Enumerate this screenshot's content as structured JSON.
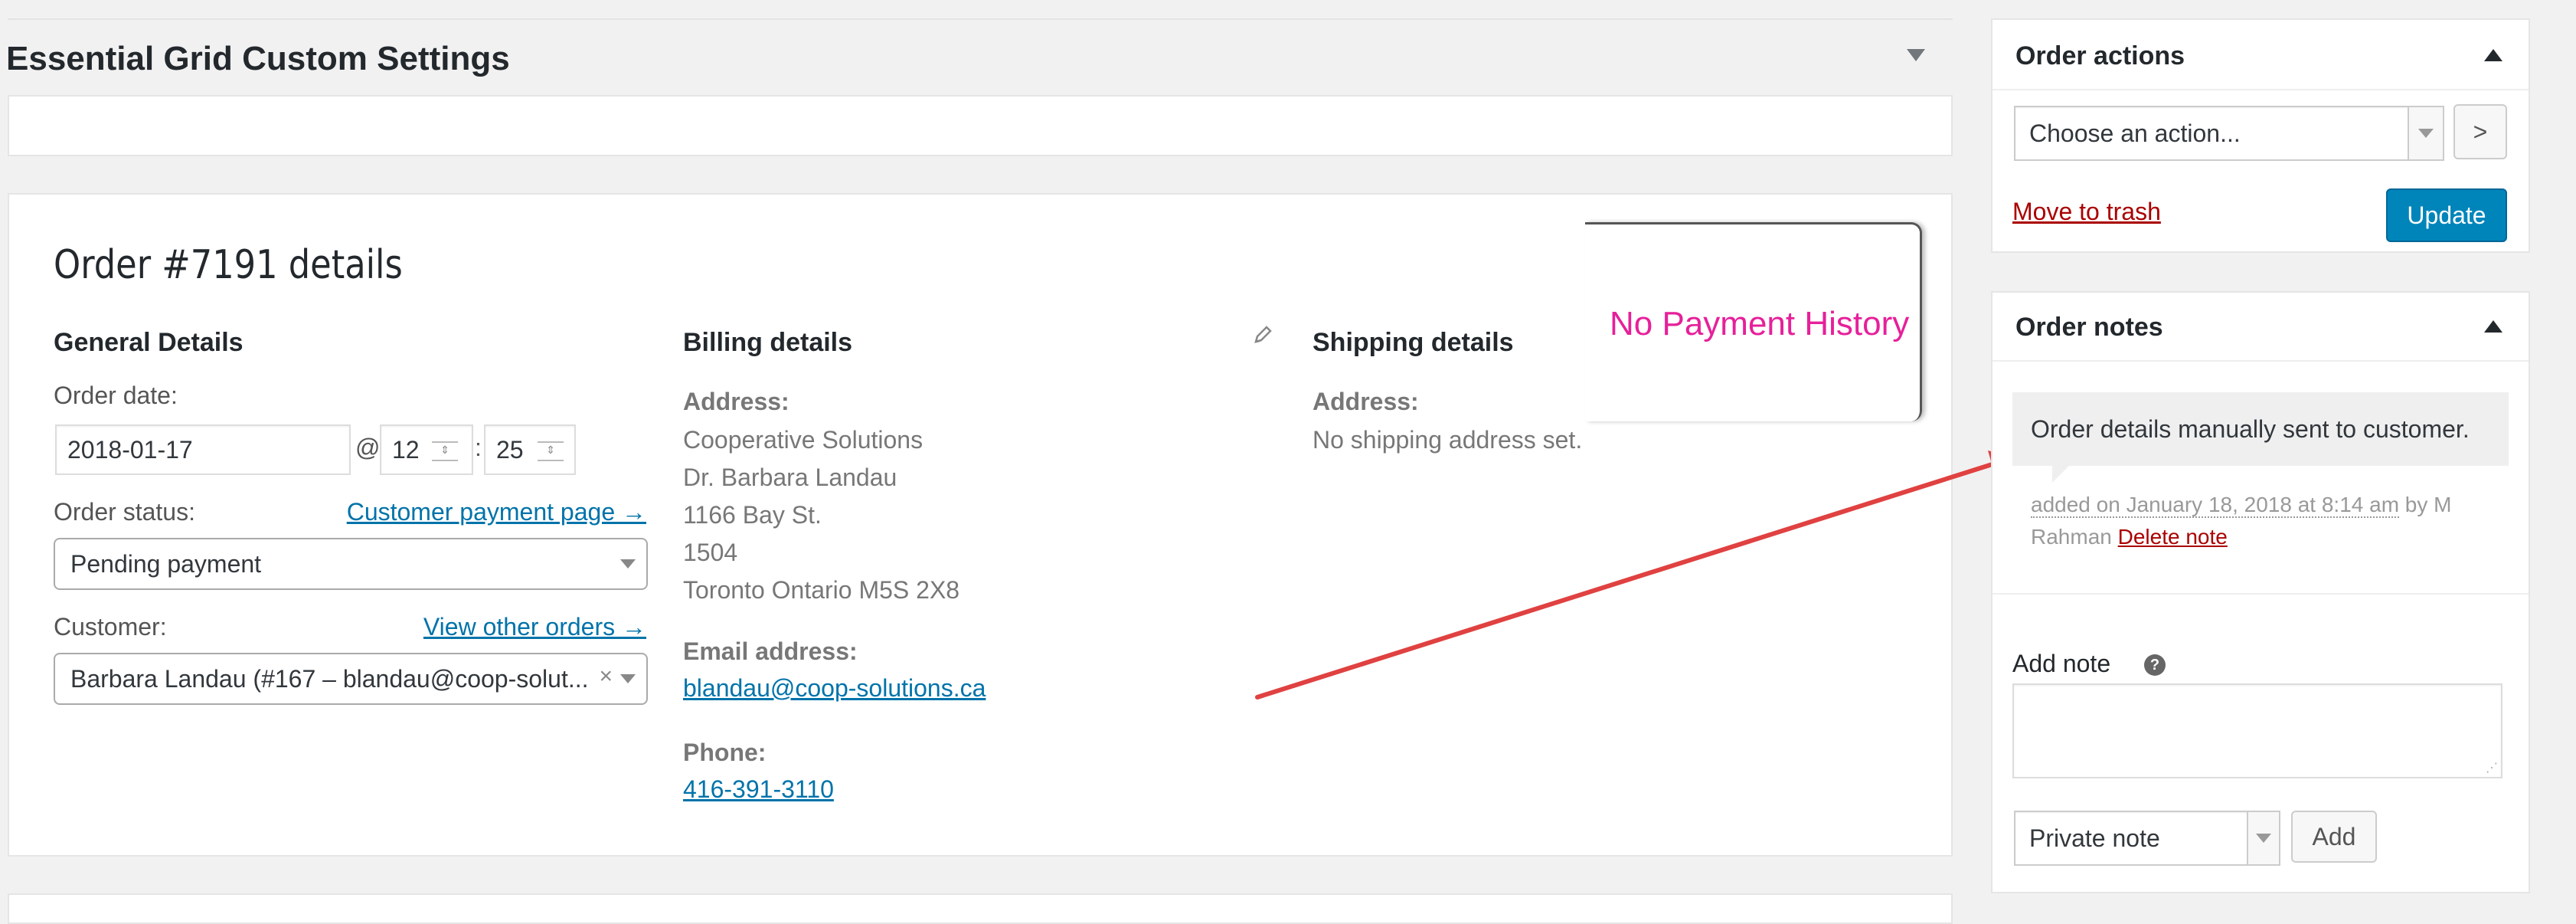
{
  "essential_grid": {
    "title": "Essential Grid Custom Settings"
  },
  "order": {
    "title": "Order #7191 details",
    "overlay_note": "No Payment History",
    "general": {
      "heading": "General Details",
      "order_date_label": "Order date:",
      "date_value": "2018-01-17",
      "at_sign": "@",
      "hour": "12",
      "colon": ":",
      "minute": "25",
      "status_label": "Order status:",
      "payment_page_link": "Customer payment page →",
      "status_value": "Pending payment",
      "customer_label": "Customer:",
      "view_orders_link": "View other orders →",
      "customer_value": "Barbara Landau (#167 – blandau@coop-solut...",
      "clear_glyph": "×"
    },
    "billing": {
      "heading": "Billing details",
      "address_label": "Address:",
      "address_lines": [
        "Cooperative Solutions",
        "Dr. Barbara Landau",
        "1166 Bay St.",
        "1504",
        "Toronto Ontario M5S 2X8"
      ],
      "email_label": "Email address:",
      "email": "blandau@coop-solutions.ca",
      "phone_label": "Phone:",
      "phone": "416-391-3110"
    },
    "shipping": {
      "heading": "Shipping details",
      "address_label": "Address:",
      "address_value": "No shipping address set."
    }
  },
  "order_actions": {
    "title": "Order actions",
    "select_value": "Choose an action...",
    "go_glyph": ">",
    "trash_link": "Move to trash",
    "update_button": "Update"
  },
  "order_notes": {
    "title": "Order notes",
    "note_text": "Order details manually sent to customer.",
    "meta_added": "added on January 18, 2018 at 8:14 am",
    "meta_by": " by M Rahman ",
    "delete_link": "Delete note",
    "add_note_label": "Add note",
    "help_glyph": "?",
    "note_type": "Private note",
    "add_button": "Add"
  },
  "icons": {
    "collapse": "triangle-down-icon",
    "expand": "triangle-up-icon",
    "edit": "pencil-icon",
    "help": "help-icon",
    "annotation": "red-arrow-annotation"
  },
  "colors": {
    "link": "#0073aa",
    "primary_button": "#0085ba",
    "trash": "#a00",
    "annotation_text": "#e6209a",
    "arrow": "#e04141"
  }
}
